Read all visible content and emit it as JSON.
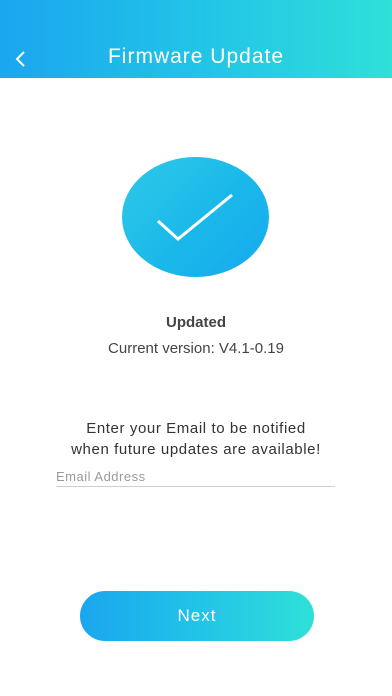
{
  "header": {
    "title": "Firmware Update",
    "back_icon": "chevron-left-icon"
  },
  "status": {
    "icon": "checkmark-icon",
    "title": "Updated",
    "version": "Current version: V4.1-0.19"
  },
  "notify": {
    "line1": "Enter your Email to be notified",
    "line2": "when future updates are available!"
  },
  "email": {
    "placeholder": "Email Address",
    "value": ""
  },
  "next_button": {
    "label": "Next"
  },
  "colors": {
    "gradient_start": "#1aa6f0",
    "gradient_end": "#2ee0d8",
    "text": "#444444"
  }
}
